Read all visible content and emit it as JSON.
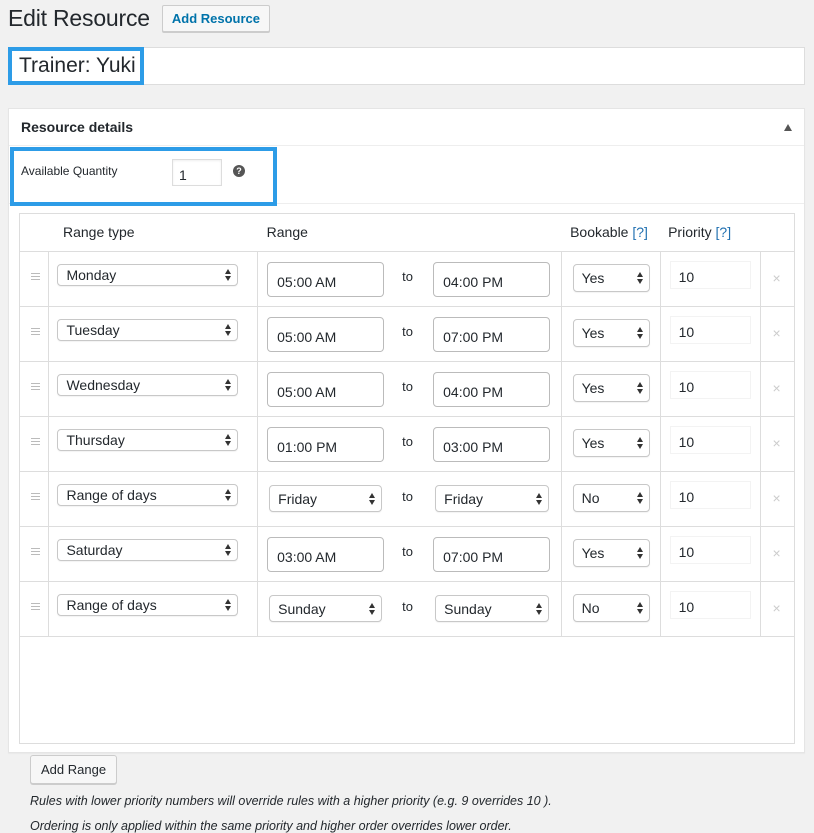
{
  "header": {
    "title": "Edit Resource",
    "add_button": "Add Resource"
  },
  "resource_title": "Trainer: Yuki",
  "highlight_color": "#2d9ce7",
  "panel": {
    "title": "Resource details",
    "quantity": {
      "label": "Available Quantity",
      "value": "1",
      "help_icon": "?"
    },
    "table": {
      "headers": {
        "range_type": "Range type",
        "range": "Range",
        "bookable": "Bookable",
        "bookable_help": "[?]",
        "priority": "Priority",
        "priority_help": "[?]"
      },
      "to_label": "to",
      "delete_icon": "×",
      "rows": [
        {
          "type": "Monday",
          "kind": "time",
          "from": "05:00 AM",
          "to": "04:00 PM",
          "bookable": "Yes",
          "priority": "10"
        },
        {
          "type": "Tuesday",
          "kind": "time",
          "from": "05:00 AM",
          "to": "07:00 PM",
          "bookable": "Yes",
          "priority": "10"
        },
        {
          "type": "Wednesday",
          "kind": "time",
          "from": "05:00 AM",
          "to": "04:00 PM",
          "bookable": "Yes",
          "priority": "10"
        },
        {
          "type": "Thursday",
          "kind": "time",
          "from": "01:00 PM",
          "to": "03:00 PM",
          "bookable": "Yes",
          "priority": "10"
        },
        {
          "type": "Range of days",
          "kind": "days",
          "from": "Friday",
          "to": "Friday",
          "bookable": "No",
          "priority": "10"
        },
        {
          "type": "Saturday",
          "kind": "time",
          "from": "03:00 AM",
          "to": "07:00 PM",
          "bookable": "Yes",
          "priority": "10"
        },
        {
          "type": "Range of days",
          "kind": "days",
          "from": "Sunday",
          "to": "Sunday",
          "bookable": "No",
          "priority": "10"
        }
      ]
    },
    "add_range": "Add Range",
    "notes": [
      "Rules with lower priority numbers will override rules with a higher priority (e.g. 9 overrides 10 ).",
      "Ordering is only applied within the same priority and higher order overrides lower order."
    ]
  }
}
